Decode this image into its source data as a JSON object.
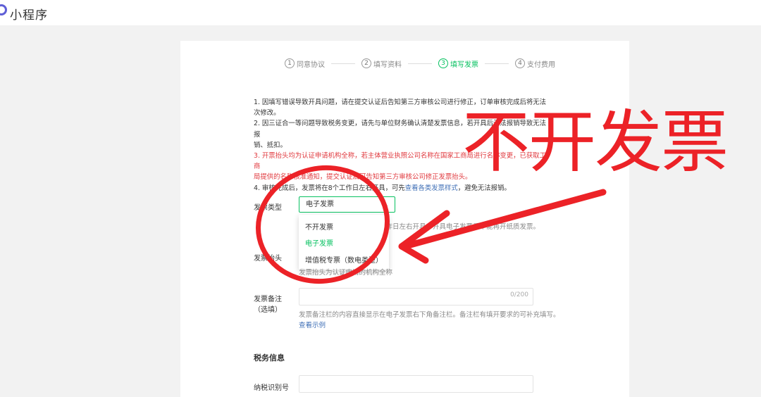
{
  "app": {
    "title": "小程序"
  },
  "steps": [
    {
      "num": "1",
      "label": "同意协议"
    },
    {
      "num": "2",
      "label": "填写资料"
    },
    {
      "num": "3",
      "label": "填写发票"
    },
    {
      "num": "4",
      "label": "支付费用"
    }
  ],
  "notes": {
    "n1_a": "1. 因填写错误导致开具问题，请在提交认证后告知第三方审核公司进行修正，订单审核完成后将无法",
    "n1_b": "次修改。",
    "n2_a": "2. 因三证合一等问题导致税务变更，请先与单位财务确认清楚发票信息，若开具后无法报销导致无法报",
    "n2_b": "销、抵扣。",
    "n3_a": "3. 开票抬头均为认证申请机构全称，若主体营业执照公司名称在国家工商局进行名称变更，已获取工商",
    "n3_b": "局提供的名称核准通知，提交认证后可告知第三方审核公司修正发票抬头。",
    "n4_a": "4. 审核完成后，发票将在8个工作日左右开具，可先",
    "n4_link": "查看各类发票样式",
    "n4_b": "，避免无法报销。"
  },
  "invoice_type": {
    "label": "发票类型",
    "value": "电子发票",
    "hint": "工作日左右开具，开具电子发票后不能再开纸质发票。",
    "options": [
      "不开发票",
      "电子发票",
      "增值税专票（数电类型）"
    ]
  },
  "invoice_title": {
    "label": "发票抬头",
    "hint": "发票抬头为认证申请的机构全称"
  },
  "invoice_remark": {
    "label": "发票备注",
    "label_sub": "（选填）",
    "counter": "0/200",
    "hint": "发票备注栏的内容直接显示在电子发票右下角备注栏。备注栏有填开要求的可补充填写。",
    "example_link": "查看示例"
  },
  "tax": {
    "section_title": "税务信息",
    "id_label": "纳税识别号"
  },
  "annotation": {
    "text": "不开发票",
    "color": "#ec2227"
  },
  "colors": {
    "accent": "#07c160",
    "warning": "#e0393e",
    "link": "#3f6fb6"
  }
}
